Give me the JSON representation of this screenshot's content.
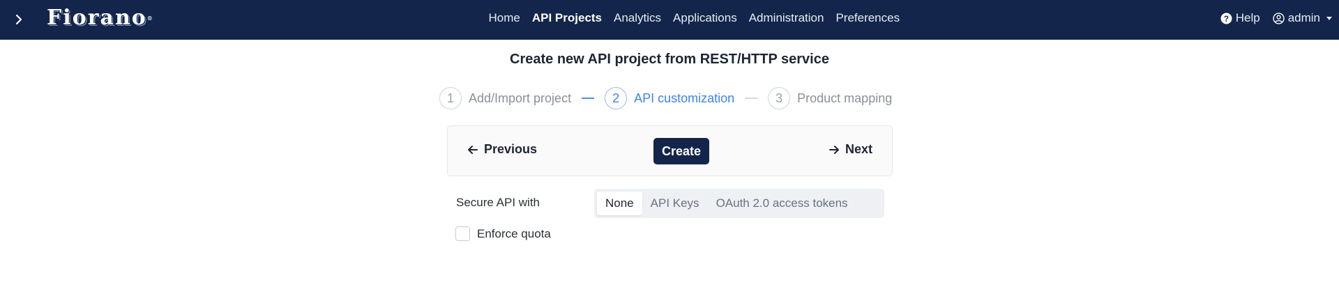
{
  "header": {
    "brand": "Fiorano",
    "brand_mark": "®",
    "nav": [
      {
        "label": "Home",
        "active": false
      },
      {
        "label": "API Projects",
        "active": true
      },
      {
        "label": "Analytics",
        "active": false
      },
      {
        "label": "Applications",
        "active": false
      },
      {
        "label": "Administration",
        "active": false
      },
      {
        "label": "Preferences",
        "active": false
      }
    ],
    "help_label": "Help",
    "user_label": "admin",
    "icons": {
      "toggle": "chevron-right-icon",
      "help": "question-circle-icon",
      "user": "user-circle-icon",
      "menu": "caret-down-icon"
    }
  },
  "page": {
    "title": "Create new API project from REST/HTTP service"
  },
  "steps": [
    {
      "number": "1",
      "label": "Add/Import project",
      "state": "done"
    },
    {
      "number": "2",
      "label": "API customization",
      "state": "current"
    },
    {
      "number": "3",
      "label": "Product mapping",
      "state": "pending"
    }
  ],
  "actions": {
    "previous_label": "Previous",
    "create_label": "Create",
    "next_label": "Next"
  },
  "security": {
    "label": "Secure API with",
    "options": [
      "None",
      "API Keys",
      "OAuth 2.0 access tokens"
    ],
    "selected": "None"
  },
  "quota": {
    "label": "Enforce quota",
    "checked": false
  },
  "colors": {
    "navbar": "#13254a",
    "accent": "#3b82f6",
    "primary_button": "#13254a"
  }
}
